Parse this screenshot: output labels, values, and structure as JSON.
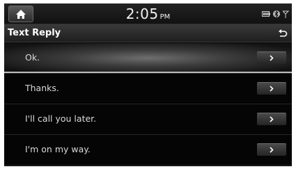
{
  "status_bar": {
    "time": "2:05",
    "am_pm": "PM"
  },
  "title_bar": {
    "title": "Text Reply"
  },
  "icons": {
    "home": "home-icon",
    "back": "back-icon",
    "battery": "battery-icon",
    "bluetooth": "bluetooth-icon",
    "signal": "signal-icon",
    "chevron": "chevron-right-icon"
  },
  "replies": [
    {
      "label": "Ok.",
      "selected": true
    },
    {
      "label": "Thanks.",
      "selected": false
    },
    {
      "label": "I'll call you later.",
      "selected": false
    },
    {
      "label": "I'm on my way.",
      "selected": false
    }
  ]
}
